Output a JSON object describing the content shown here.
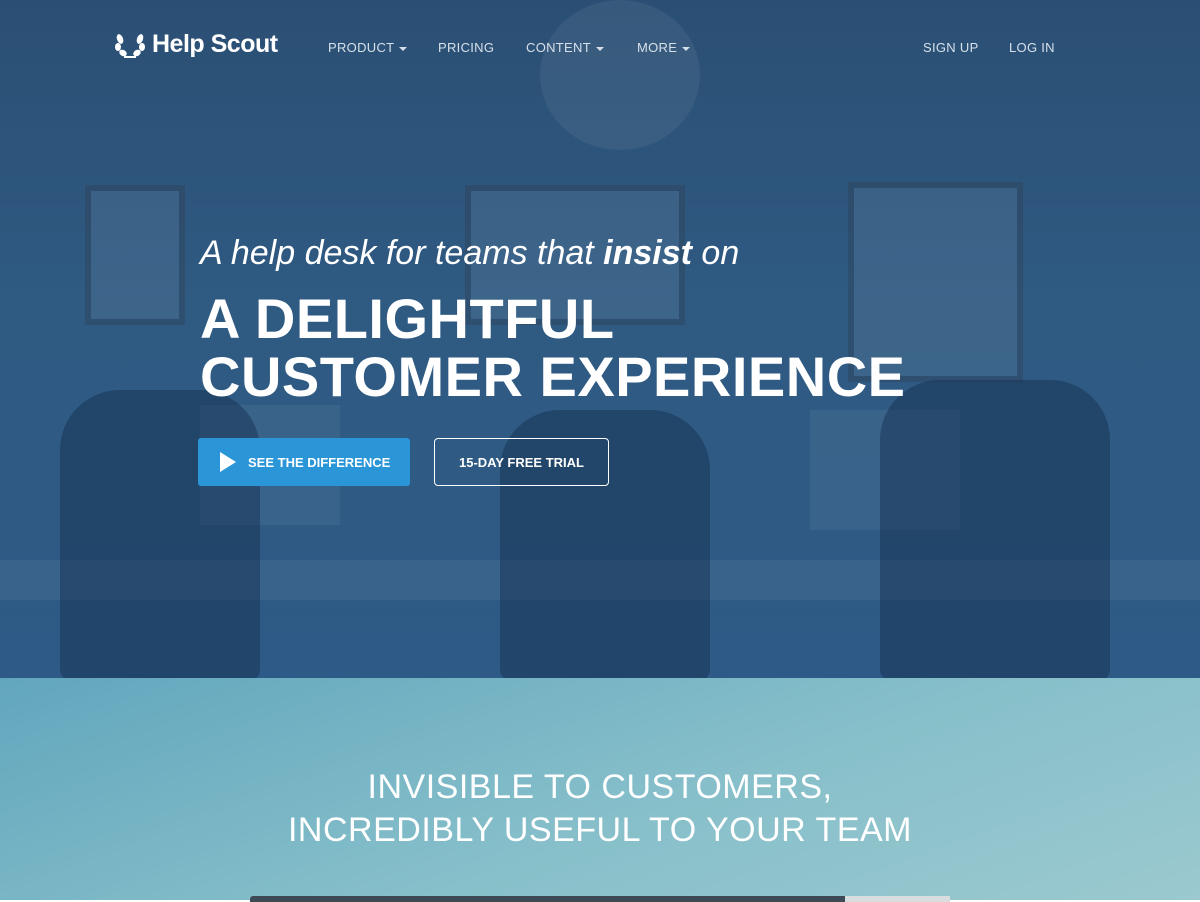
{
  "nav": {
    "brand": "Help Scout",
    "items": [
      {
        "label": "PRODUCT",
        "dropdown": true
      },
      {
        "label": "PRICING",
        "dropdown": false
      },
      {
        "label": "CONTENT",
        "dropdown": true
      },
      {
        "label": "MORE",
        "dropdown": true
      }
    ],
    "sign_up": "SIGN UP",
    "log_in": "LOG IN"
  },
  "hero": {
    "tagline_pre": "A help desk for teams that ",
    "tagline_bold": "insist",
    "tagline_post": " on",
    "headline_line1": "A DELIGHTFUL",
    "headline_line2": "CUSTOMER EXPERIENCE",
    "primary_button": "SEE THE DIFFERENCE",
    "secondary_button": "15-DAY FREE TRIAL"
  },
  "section2": {
    "title_line1": "INVISIBLE TO CUSTOMERS,",
    "title_line2": "INCREDIBLY USEFUL TO YOUR TEAM"
  },
  "colors": {
    "hero_bg": "#2f5a82",
    "accent": "#2a96d8",
    "section2_bg": "#86bfca"
  }
}
